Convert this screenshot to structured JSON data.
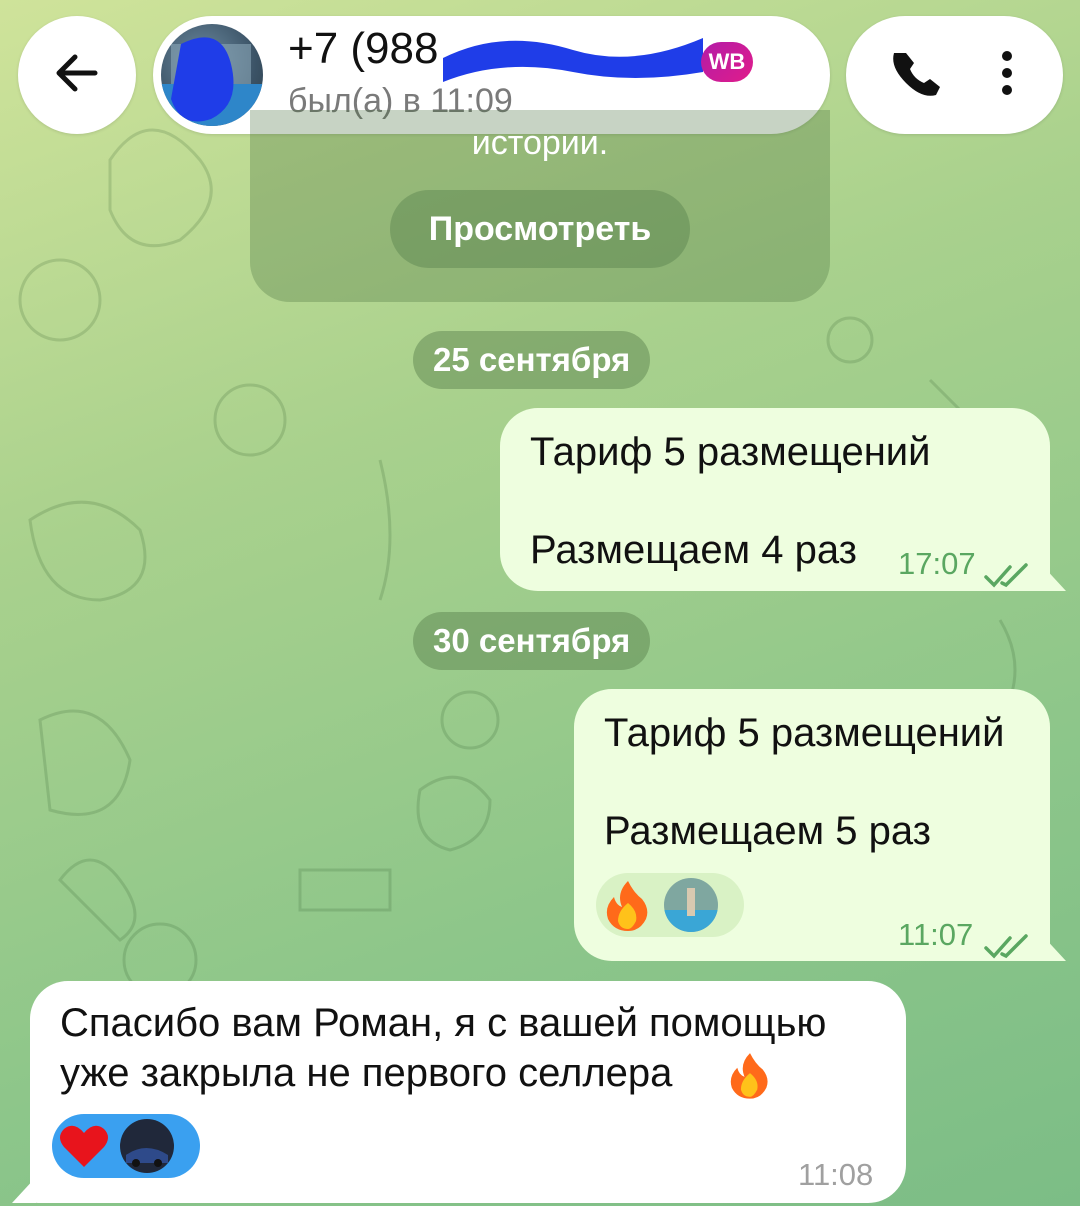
{
  "header": {
    "back_icon": "arrow-left-icon",
    "contact_name": "+7 (988",
    "contact_badge": "WB",
    "contact_status": "был(а) в 11:09",
    "call_icon": "phone-icon",
    "more_icon": "more-vertical-icon"
  },
  "story_card": {
    "text": "истории.",
    "view_button": "Просмотреть"
  },
  "messages": [
    {
      "date": "25 сентября",
      "direction": "out",
      "line1": "Тариф 5 размещений",
      "line2": "Размещаем 4 раз",
      "time": "17:07",
      "status": "read"
    },
    {
      "date": "30 сентября",
      "direction": "out",
      "line1": "Тариф 5 размещений",
      "line2": "Размещаем 5 раз",
      "reaction": "fire-emoji",
      "time": "11:07",
      "status": "read"
    },
    {
      "direction": "in",
      "line1": "Спасибо вам Роман, я с вашей помощью",
      "line2": "уже закрыла не первого селлера",
      "inline_emoji": "fire-emoji",
      "reaction": "heart-emoji",
      "time": "11:08"
    }
  ],
  "colors": {
    "outgoing_bubble": "#eefedf",
    "incoming_bubble": "#ffffff",
    "read_checks": "#5aa761",
    "reaction_pill_selected": "#3aa0f0"
  }
}
